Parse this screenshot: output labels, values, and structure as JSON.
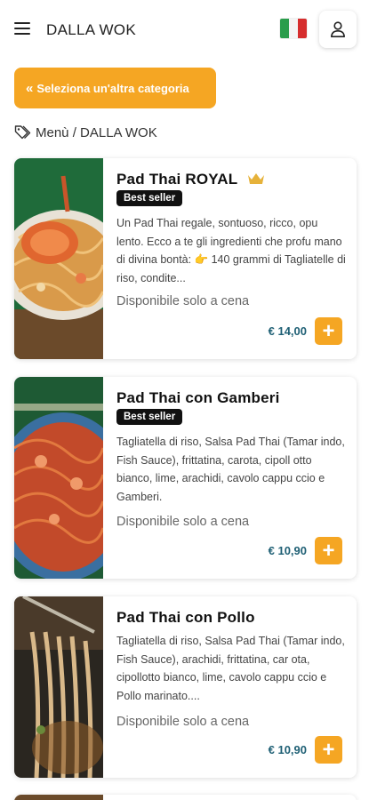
{
  "header": {
    "title": "DALLA WOK",
    "menu_icon": "hamburger-menu-icon",
    "flag_icon": "italian-flag-icon",
    "user_icon": "user-icon"
  },
  "category_button": {
    "label": "Seleziona un'altra categoria",
    "chevron": "«"
  },
  "breadcrumb": {
    "text": "Menù / DALLA WOK",
    "icon": "tag-icon"
  },
  "products": [
    {
      "name": "Pad Thai ROYAL",
      "crown_icon": "crown-icon",
      "badge": "Best seller",
      "description": "Un Pad Thai regale, sontuoso, ricco, opu lento. Ecco a te gli ingredienti che profu mano di divina bontà: 👉 140 grammi di Tagliatelle di riso, condite...",
      "availability": "Disponibile solo a cena",
      "price": "€ 14,00",
      "add_label": "+"
    },
    {
      "name": "Pad Thai con Gamberi",
      "badge": "Best seller",
      "description": "Tagliatella di riso, Salsa Pad Thai (Tamar indo, Fish Sauce), frittatina, carota, cipoll otto bianco, lime, arachidi, cavolo cappu ccio e Gamberi.",
      "availability": "Disponibile solo a cena",
      "price": "€ 10,90",
      "add_label": "+"
    },
    {
      "name": "Pad Thai con Pollo",
      "description": "Tagliatella di riso, Salsa Pad Thai (Tamar indo, Fish Sauce), arachidi, frittatina, car ota, cipollotto bianco, lime, cavolo cappu ccio e Pollo marinato....",
      "availability": "Disponibile solo a cena",
      "price": "€ 10,90",
      "add_label": "+"
    }
  ],
  "colors": {
    "accent": "#f5a623",
    "price": "#1e5f74",
    "badge": "#111111"
  }
}
